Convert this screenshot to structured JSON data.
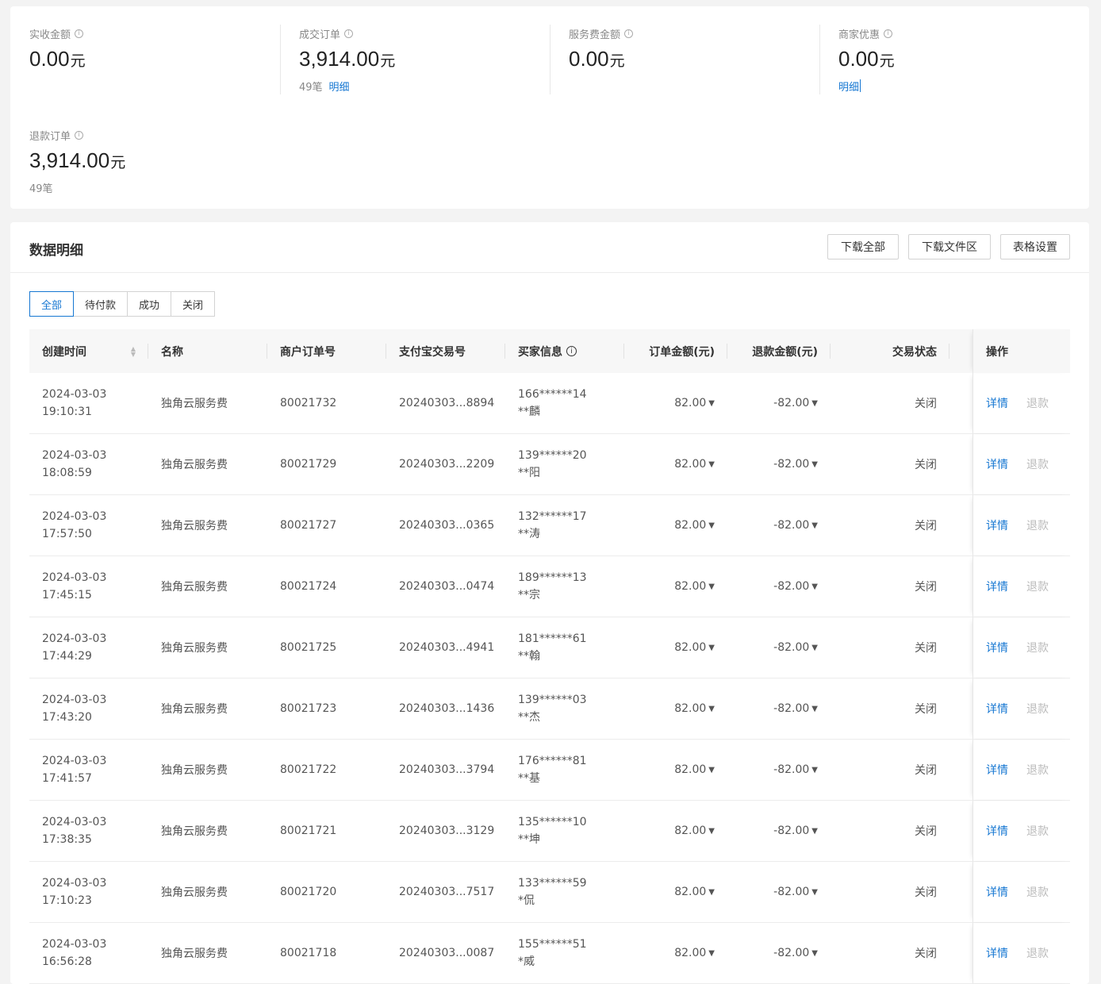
{
  "summary": {
    "stats": [
      {
        "label": "实收金额",
        "amount": "0.00",
        "unit": "元",
        "count": "",
        "link": ""
      },
      {
        "label": "成交订单",
        "amount": "3,914.00",
        "unit": "元",
        "count": "49笔",
        "link": "明细"
      },
      {
        "label": "服务费金额",
        "amount": "0.00",
        "unit": "元",
        "count": "",
        "link": ""
      },
      {
        "label": "商家优惠",
        "amount": "0.00",
        "unit": "元",
        "count": "",
        "link": "明细"
      },
      {
        "label": "退款订单",
        "amount": "3,914.00",
        "unit": "元",
        "count": "49笔",
        "link": ""
      }
    ]
  },
  "detail": {
    "title": "数据明细",
    "buttons": {
      "download_all": "下载全部",
      "download_area": "下载文件区",
      "table_settings": "表格设置"
    },
    "tabs": [
      "全部",
      "待付款",
      "成功",
      "关闭"
    ],
    "active_tab": "全部",
    "columns": [
      "创建时间",
      "名称",
      "商户订单号",
      "支付宝交易号",
      "买家信息",
      "订单金额(元)",
      "退款金额(元)",
      "交易状态",
      "操作"
    ],
    "rows": [
      {
        "date": "2024-03-03",
        "time": "19:10:31",
        "name": "独角云服务费",
        "order_no": "80021732",
        "trade_no": "20240303...8894",
        "buyer_phone": "166******14",
        "buyer_name": "**麟",
        "amount": "82.00",
        "refund": "-82.00",
        "status": "关闭",
        "detail": "详情",
        "refund_action": "退款"
      },
      {
        "date": "2024-03-03",
        "time": "18:08:59",
        "name": "独角云服务费",
        "order_no": "80021729",
        "trade_no": "20240303...2209",
        "buyer_phone": "139******20",
        "buyer_name": "**阳",
        "amount": "82.00",
        "refund": "-82.00",
        "status": "关闭",
        "detail": "详情",
        "refund_action": "退款"
      },
      {
        "date": "2024-03-03",
        "time": "17:57:50",
        "name": "独角云服务费",
        "order_no": "80021727",
        "trade_no": "20240303...0365",
        "buyer_phone": "132******17",
        "buyer_name": "**涛",
        "amount": "82.00",
        "refund": "-82.00",
        "status": "关闭",
        "detail": "详情",
        "refund_action": "退款"
      },
      {
        "date": "2024-03-03",
        "time": "17:45:15",
        "name": "独角云服务费",
        "order_no": "80021724",
        "trade_no": "20240303...0474",
        "buyer_phone": "189******13",
        "buyer_name": "**宗",
        "amount": "82.00",
        "refund": "-82.00",
        "status": "关闭",
        "detail": "详情",
        "refund_action": "退款"
      },
      {
        "date": "2024-03-03",
        "time": "17:44:29",
        "name": "独角云服务费",
        "order_no": "80021725",
        "trade_no": "20240303...4941",
        "buyer_phone": "181******61",
        "buyer_name": "**翰",
        "amount": "82.00",
        "refund": "-82.00",
        "status": "关闭",
        "detail": "详情",
        "refund_action": "退款"
      },
      {
        "date": "2024-03-03",
        "time": "17:43:20",
        "name": "独角云服务费",
        "order_no": "80021723",
        "trade_no": "20240303...1436",
        "buyer_phone": "139******03",
        "buyer_name": "**杰",
        "amount": "82.00",
        "refund": "-82.00",
        "status": "关闭",
        "detail": "详情",
        "refund_action": "退款"
      },
      {
        "date": "2024-03-03",
        "time": "17:41:57",
        "name": "独角云服务费",
        "order_no": "80021722",
        "trade_no": "20240303...3794",
        "buyer_phone": "176******81",
        "buyer_name": "**基",
        "amount": "82.00",
        "refund": "-82.00",
        "status": "关闭",
        "detail": "详情",
        "refund_action": "退款"
      },
      {
        "date": "2024-03-03",
        "time": "17:38:35",
        "name": "独角云服务费",
        "order_no": "80021721",
        "trade_no": "20240303...3129",
        "buyer_phone": "135******10",
        "buyer_name": "**坤",
        "amount": "82.00",
        "refund": "-82.00",
        "status": "关闭",
        "detail": "详情",
        "refund_action": "退款"
      },
      {
        "date": "2024-03-03",
        "time": "17:10:23",
        "name": "独角云服务费",
        "order_no": "80021720",
        "trade_no": "20240303...7517",
        "buyer_phone": "133******59",
        "buyer_name": "*侃",
        "amount": "82.00",
        "refund": "-82.00",
        "status": "关闭",
        "detail": "详情",
        "refund_action": "退款"
      },
      {
        "date": "2024-03-03",
        "time": "16:56:28",
        "name": "独角云服务费",
        "order_no": "80021718",
        "trade_no": "20240303...0087",
        "buyer_phone": "155******51",
        "buyer_name": "*威",
        "amount": "82.00",
        "refund": "-82.00",
        "status": "关闭",
        "detail": "详情",
        "refund_action": "退款"
      }
    ]
  },
  "colors": {
    "accent": "#1677d2",
    "disabled": "#bbbbbb"
  },
  "icons": {
    "info": "info-circle-icon",
    "sort": "sort-icon",
    "dropdown": "caret-down-icon"
  }
}
